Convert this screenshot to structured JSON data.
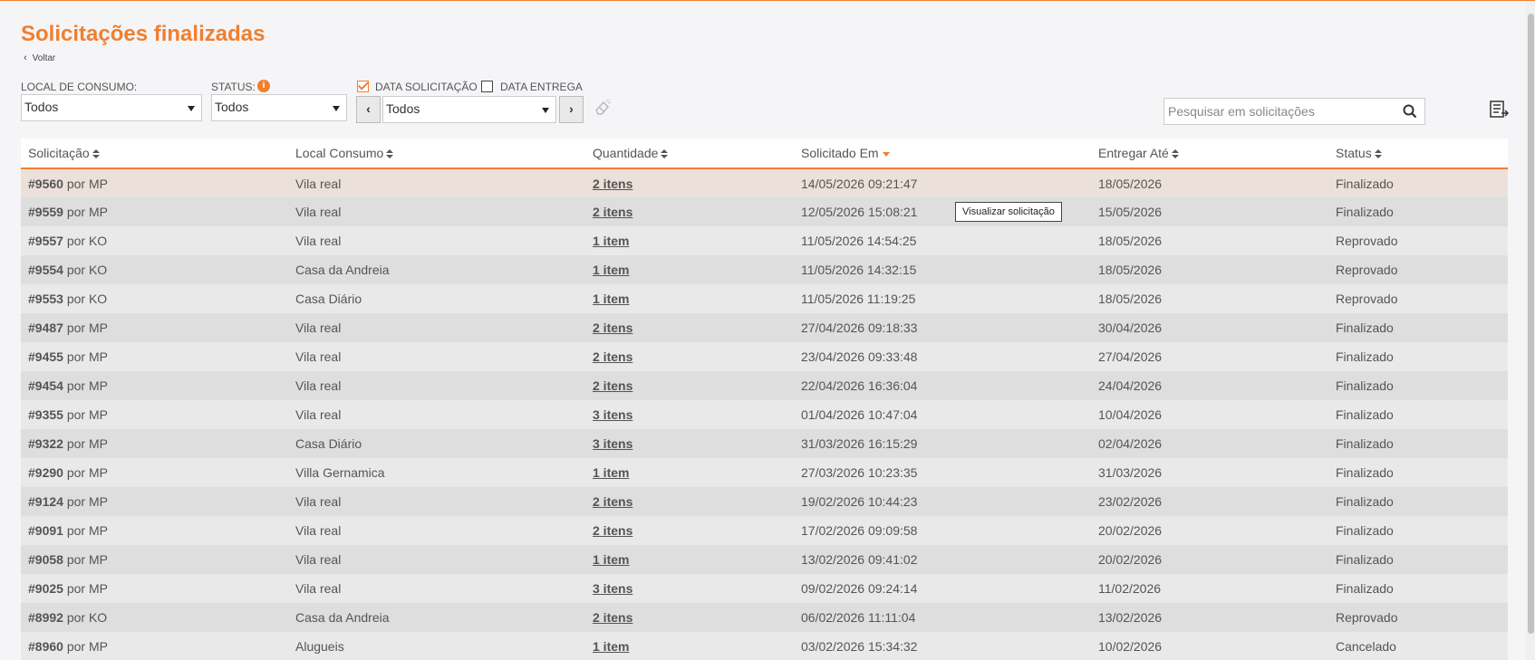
{
  "page_title": "Solicitações finalizadas",
  "back_label": "Voltar",
  "filters": {
    "local_label": "LOCAL DE CONSUMO:",
    "local_value": "Todos",
    "status_label": "STATUS:",
    "status_value": "Todos",
    "info_glyph": "i",
    "date_solicitacao_label": "DATA SOLICITAÇÃO",
    "date_solicitacao_checked": true,
    "date_entrega_label": "DATA ENTREGA",
    "date_entrega_checked": false,
    "period_value": "Todos",
    "prev_glyph": "‹",
    "next_glyph": "›"
  },
  "search": {
    "placeholder": "Pesquisar em solicitações"
  },
  "columns": [
    "Solicitação",
    "Local Consumo",
    "Quantidade",
    "Solicitado Em",
    "Entregar Até",
    "Status"
  ],
  "sorted_column": "Solicitado Em",
  "rows": [
    {
      "id": "#9560",
      "by": "por MP",
      "local": "Vila real",
      "qty": "2 itens",
      "requested": "14/05/2026 09:21:47",
      "deliver": "18/05/2026",
      "status": "Finalizado"
    },
    {
      "id": "#9559",
      "by": "por MP",
      "local": "Vila real",
      "qty": "2 itens",
      "requested": "12/05/2026 15:08:21",
      "deliver": "15/05/2026",
      "status": "Finalizado"
    },
    {
      "id": "#9557",
      "by": "por KO",
      "local": "Vila real",
      "qty": "1 item",
      "requested": "11/05/2026 14:54:25",
      "deliver": "18/05/2026",
      "status": "Reprovado"
    },
    {
      "id": "#9554",
      "by": "por KO",
      "local": "Casa da Andreia",
      "qty": "1 item",
      "requested": "11/05/2026 14:32:15",
      "deliver": "18/05/2026",
      "status": "Reprovado"
    },
    {
      "id": "#9553",
      "by": "por KO",
      "local": "Casa Diário",
      "qty": "1 item",
      "requested": "11/05/2026 11:19:25",
      "deliver": "18/05/2026",
      "status": "Reprovado"
    },
    {
      "id": "#9487",
      "by": "por MP",
      "local": "Vila real",
      "qty": "2 itens",
      "requested": "27/04/2026 09:18:33",
      "deliver": "30/04/2026",
      "status": "Finalizado"
    },
    {
      "id": "#9455",
      "by": "por MP",
      "local": "Vila real",
      "qty": "2 itens",
      "requested": "23/04/2026 09:33:48",
      "deliver": "27/04/2026",
      "status": "Finalizado"
    },
    {
      "id": "#9454",
      "by": "por MP",
      "local": "Vila real",
      "qty": "2 itens",
      "requested": "22/04/2026 16:36:04",
      "deliver": "24/04/2026",
      "status": "Finalizado"
    },
    {
      "id": "#9355",
      "by": "por MP",
      "local": "Vila real",
      "qty": "3 itens",
      "requested": "01/04/2026 10:47:04",
      "deliver": "10/04/2026",
      "status": "Finalizado"
    },
    {
      "id": "#9322",
      "by": "por MP",
      "local": "Casa Diário",
      "qty": "3 itens",
      "requested": "31/03/2026 16:15:29",
      "deliver": "02/04/2026",
      "status": "Finalizado"
    },
    {
      "id": "#9290",
      "by": "por MP",
      "local": "Villa Gernamica",
      "qty": "1 item",
      "requested": "27/03/2026 10:23:35",
      "deliver": "31/03/2026",
      "status": "Finalizado"
    },
    {
      "id": "#9124",
      "by": "por MP",
      "local": "Vila real",
      "qty": "2 itens",
      "requested": "19/02/2026 10:44:23",
      "deliver": "23/02/2026",
      "status": "Finalizado"
    },
    {
      "id": "#9091",
      "by": "por MP",
      "local": "Vila real",
      "qty": "2 itens",
      "requested": "17/02/2026 09:09:58",
      "deliver": "20/02/2026",
      "status": "Finalizado"
    },
    {
      "id": "#9058",
      "by": "por MP",
      "local": "Vila real",
      "qty": "1 item",
      "requested": "13/02/2026 09:41:02",
      "deliver": "20/02/2026",
      "status": "Finalizado"
    },
    {
      "id": "#9025",
      "by": "por MP",
      "local": "Vila real",
      "qty": "3 itens",
      "requested": "09/02/2026 09:24:14",
      "deliver": "11/02/2026",
      "status": "Finalizado"
    },
    {
      "id": "#8992",
      "by": "por KO",
      "local": "Casa da Andreia",
      "qty": "2 itens",
      "requested": "06/02/2026 11:11:04",
      "deliver": "13/02/2026",
      "status": "Reprovado"
    },
    {
      "id": "#8960",
      "by": "por MP",
      "local": "Alugueis",
      "qty": "1 item",
      "requested": "03/02/2026 15:34:32",
      "deliver": "10/02/2026",
      "status": "Cancelado"
    }
  ],
  "tooltip": "Visualizar solicitação",
  "colors": {
    "accent": "#f07f2f",
    "row_highlight": "#ebe1da"
  }
}
